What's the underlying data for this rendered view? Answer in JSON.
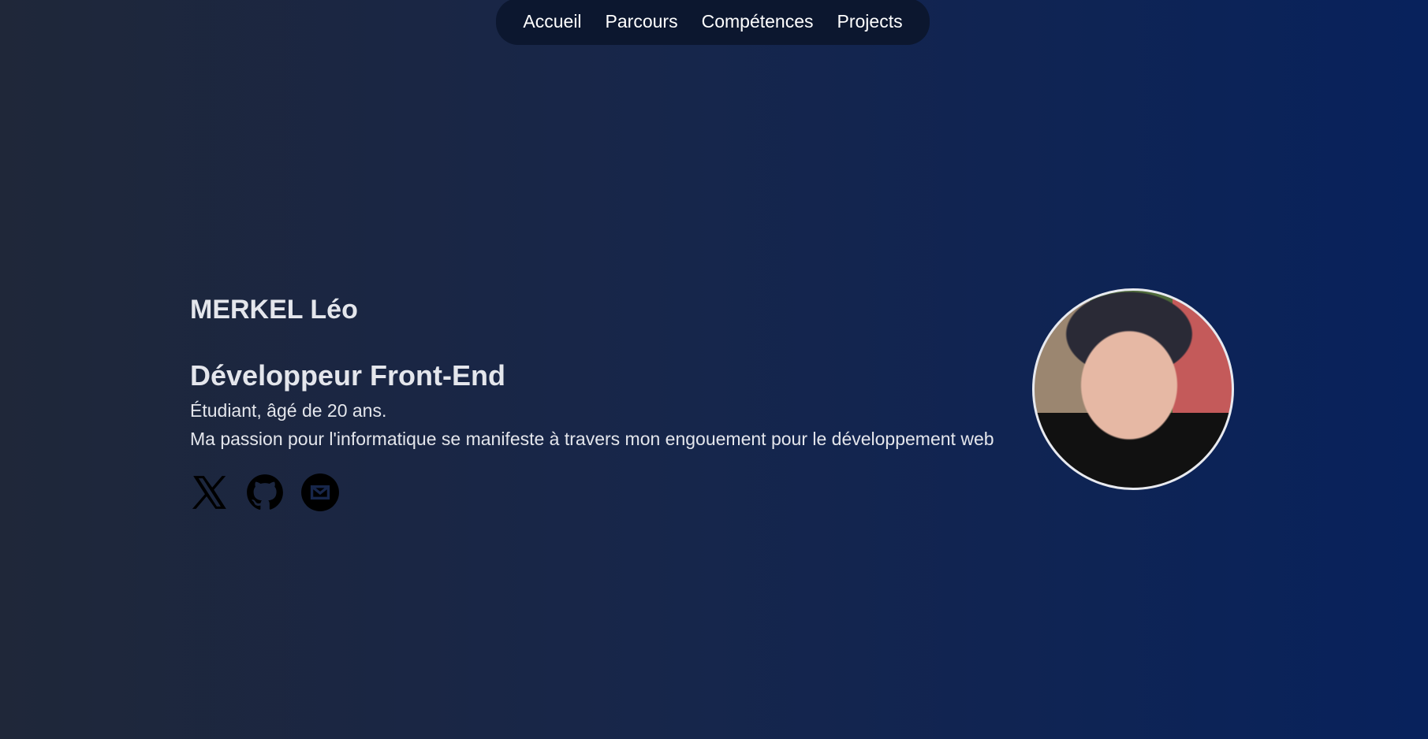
{
  "nav": {
    "items": [
      "Accueil",
      "Parcours",
      "Compétences",
      "Projects"
    ]
  },
  "hero": {
    "name": "MERKEL Léo",
    "title": "Développeur Front-End",
    "subtitle": "Étudiant, âgé de 20 ans.",
    "description": "Ma passion pour l'informatique se manifeste à travers mon engouement pour le développement web"
  },
  "socials": [
    "x-icon",
    "github-icon",
    "mail-icon"
  ]
}
